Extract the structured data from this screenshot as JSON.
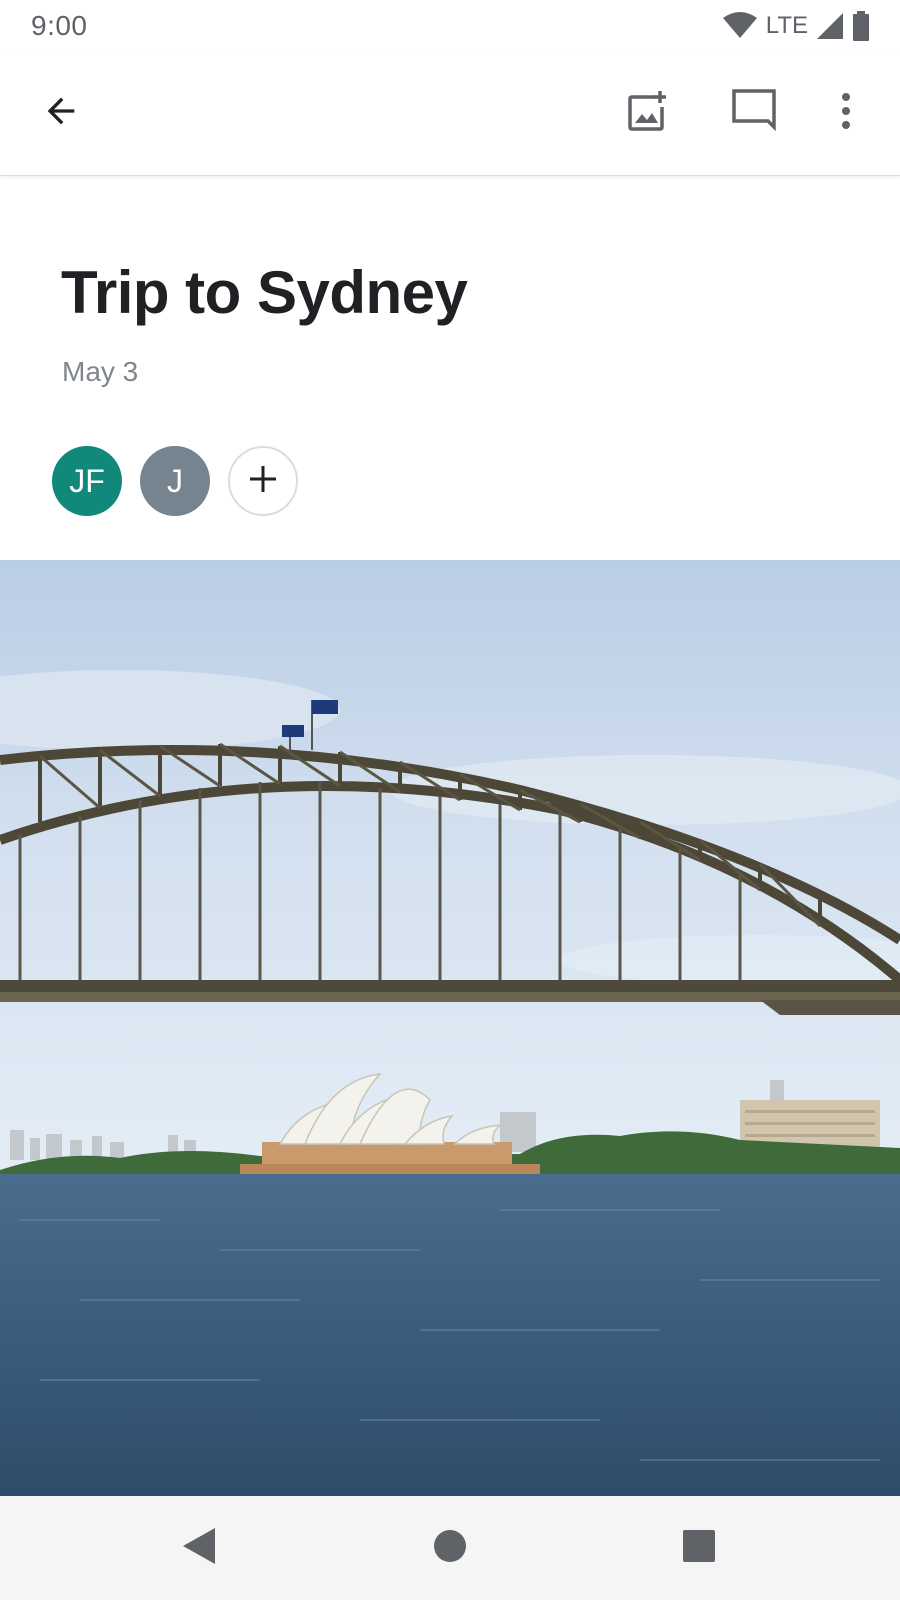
{
  "status_bar": {
    "time": "9:00",
    "network": "LTE",
    "icons": [
      "wifi-icon",
      "cell-signal-icon",
      "battery-icon"
    ]
  },
  "app_bar": {
    "icons": [
      "arrow-back-icon",
      "add-photo-icon",
      "comment-icon",
      "more-vert-icon"
    ]
  },
  "album": {
    "title": "Trip to Sydney",
    "date": "May 3"
  },
  "collaborators": [
    {
      "initials": "JF",
      "color": "#11897a"
    },
    {
      "initials": "J",
      "color": "#76848f"
    }
  ],
  "add_collaborator_icon": "plus-icon",
  "photo": {
    "subject": "harbour-bridge-and-opera-house-photo"
  },
  "nav_bar": {
    "icons": [
      "nav-back-icon",
      "nav-home-icon",
      "nav-recents-icon"
    ]
  },
  "colors": {
    "primary_text": "#202124",
    "secondary_text": "#80868b",
    "icon": "#5f6368",
    "divider": "#dadce0"
  }
}
